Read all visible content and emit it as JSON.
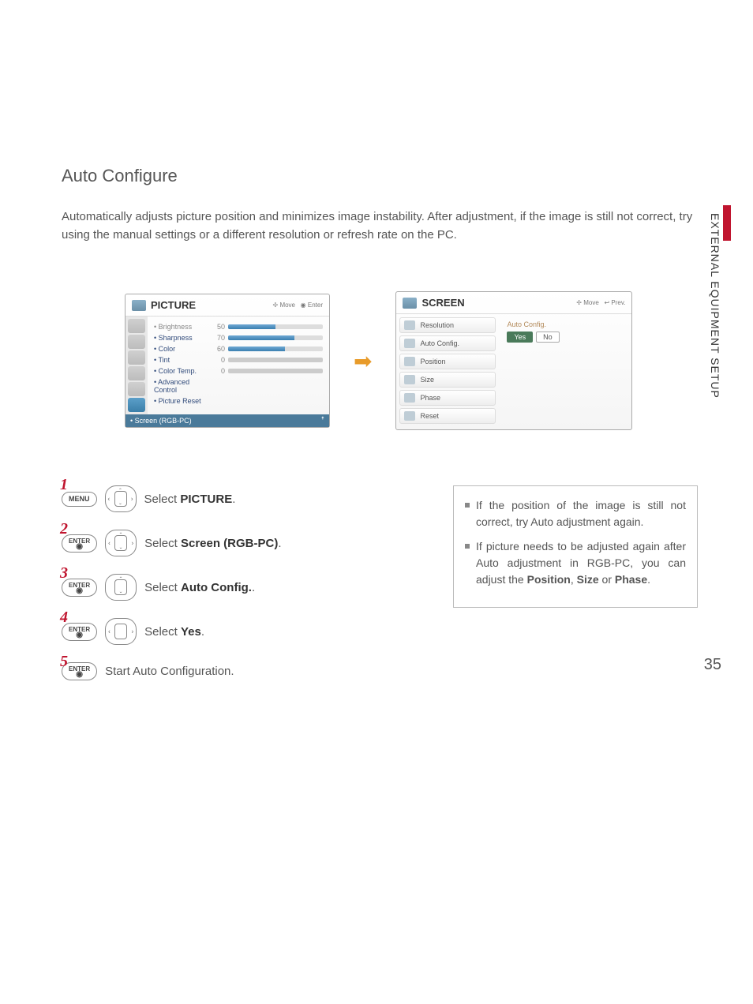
{
  "side_label": "EXTERNAL EQUIPMENT SETUP",
  "page_number": "35",
  "heading": "Auto Configure",
  "intro": "Automatically adjusts picture position and minimizes image instability. After adjustment, if the image is still not correct, try using the manual settings or a different resolution or refresh rate on the PC.",
  "picture_osd": {
    "title": "PICTURE",
    "hint_move": "Move",
    "hint_enter": "Enter",
    "items": [
      {
        "label": "Brightness",
        "value": "50",
        "fill": 50,
        "dim": true
      },
      {
        "label": "Sharpness",
        "value": "70",
        "fill": 70,
        "dim": false
      },
      {
        "label": "Color",
        "value": "60",
        "fill": 60,
        "dim": false
      },
      {
        "label": "Tint",
        "value": "0",
        "tint": true,
        "dim": false
      },
      {
        "label": "Color Temp.",
        "value": "0",
        "tint": true,
        "dim": false
      },
      {
        "label": "Advanced Control",
        "no_bar": true
      },
      {
        "label": "Picture Reset",
        "no_bar": true
      }
    ],
    "footer": "Screen (RGB-PC)"
  },
  "screen_osd": {
    "title": "SCREEN",
    "hint_move": "Move",
    "hint_prev": "Prev.",
    "items": [
      "Resolution",
      "Auto Config.",
      "Position",
      "Size",
      "Phase",
      "Reset"
    ],
    "right_label": "Auto Config.",
    "yes": "Yes",
    "no": "No"
  },
  "steps": [
    {
      "num": "1",
      "btn": "MENU",
      "pad": "hv",
      "pre": "Select ",
      "bold": "PICTURE",
      "post": "."
    },
    {
      "num": "2",
      "btn": "ENTER",
      "pad": "hv",
      "pre": "Select ",
      "bold": "Screen (RGB-PC)",
      "post": "."
    },
    {
      "num": "3",
      "btn": "ENTER",
      "pad": "v",
      "pre": "Select ",
      "bold": "Auto Config.",
      "post": "."
    },
    {
      "num": "4",
      "btn": "ENTER",
      "pad": "h",
      "pre": "Select ",
      "bold": "Yes",
      "post": "."
    },
    {
      "num": "5",
      "btn": "ENTER",
      "pad": "",
      "pre": "Start Auto Configuration.",
      "bold": "",
      "post": ""
    }
  ],
  "tips": {
    "t1a": "If the position of the image is still not correct, try Auto adjustment again.",
    "t2a": "If picture needs to be adjusted again after Auto adjustment in RGB-PC, you can adjust the ",
    "t2b": "Position",
    "t2c": ", ",
    "t2d": "Size",
    "t2e": " or ",
    "t2f": "Phase",
    "t2g": "."
  }
}
